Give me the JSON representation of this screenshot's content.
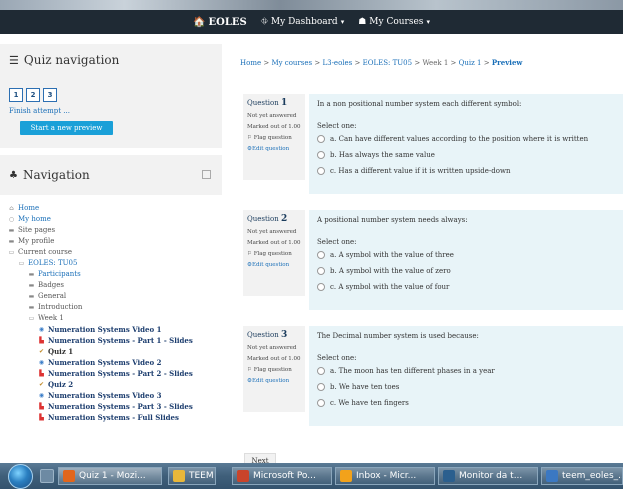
{
  "navbar": {
    "brand": "EOLES",
    "dashboard": "My Dashboard",
    "courses": "My Courses"
  },
  "quiz_nav": {
    "title": "Quiz navigation",
    "buttons": [
      "1",
      "2",
      "3"
    ],
    "finish": "Finish attempt ...",
    "preview": "Start a new preview"
  },
  "navigation": {
    "title": "Navigation",
    "items": [
      {
        "label": "Home"
      },
      {
        "label": "My home"
      },
      {
        "label": "Site pages"
      },
      {
        "label": "My profile"
      },
      {
        "label": "Current course"
      },
      {
        "label": "EOLES: TU05"
      },
      {
        "label": "Participants"
      },
      {
        "label": "Badges"
      },
      {
        "label": "General"
      },
      {
        "label": "Introduction"
      },
      {
        "label": "Week 1"
      },
      {
        "label": "Numeration Systems Video 1"
      },
      {
        "label": "Numeration Systems - Part 1 - Slides"
      },
      {
        "label": "Quiz 1"
      },
      {
        "label": "Numeration Systems Video 2"
      },
      {
        "label": "Numeration Systems - Part 2 - Slides"
      },
      {
        "label": "Quiz 2"
      },
      {
        "label": "Numeration Systems Video 3"
      },
      {
        "label": "Numeration Systems - Part 3 - Slides"
      },
      {
        "label": "Numeration Systems - Full Slides"
      }
    ]
  },
  "breadcrumb": {
    "home": "Home",
    "sep": ">",
    "courses": "My courses",
    "l3": "L3-eoles",
    "course": "EOLES: TU05",
    "week": "Week 1",
    "quiz": "Quiz 1",
    "current": "Preview"
  },
  "questions": [
    {
      "label": "Question",
      "number": "1",
      "status": "Not yet answered",
      "marked": "Marked out of 1.00",
      "flag": "Flag question",
      "edit": "Edit question",
      "text": "In a non positional number system each different symbol:",
      "select": "Select one:",
      "options": [
        "a. Can have different values according to the position where it is written",
        "b. Has always the same value",
        "c. Has a different value if it is written upside-down"
      ]
    },
    {
      "label": "Question",
      "number": "2",
      "status": "Not yet answered",
      "marked": "Marked out of 1.00",
      "flag": "Flag question",
      "edit": "Edit question",
      "text": "A positional number system needs always:",
      "select": "Select one:",
      "options": [
        "a. A symbol with the value of three",
        "b. A symbol with the value of zero",
        "c. A symbol with the value of four"
      ]
    },
    {
      "label": "Question",
      "number": "3",
      "status": "Not yet answered",
      "marked": "Marked out of 1.00",
      "flag": "Flag question",
      "edit": "Edit question",
      "text": "The Decimal number system is used because:",
      "select": "Select one:",
      "options": [
        "a. The moon has ten different phases in a year",
        "b. We have ten toes",
        "c. We have ten fingers"
      ]
    }
  ],
  "next": "Next",
  "taskbar": {
    "tasks": [
      {
        "label": "Quiz 1 - Mozi...",
        "icon_color": "#e2661c"
      },
      {
        "label": "TEEM",
        "icon_color": "#e8b73a"
      },
      {
        "label": "Microsoft Po...",
        "icon_color": "#c9442b"
      },
      {
        "label": "Inbox - Micr...",
        "icon_color": "#f2a21b"
      },
      {
        "label": "Monitor da t...",
        "icon_color": "#2b5f8e"
      },
      {
        "label": "teem_eoles_...",
        "icon_color": "#3b78c2"
      }
    ]
  },
  "colors": {
    "accent": "#1a6fb8",
    "navbar": "#1f2a34",
    "preview_button": "#1aa0d8",
    "question_bg": "#e8f4f8",
    "panel_bg": "#f2f2f2"
  }
}
